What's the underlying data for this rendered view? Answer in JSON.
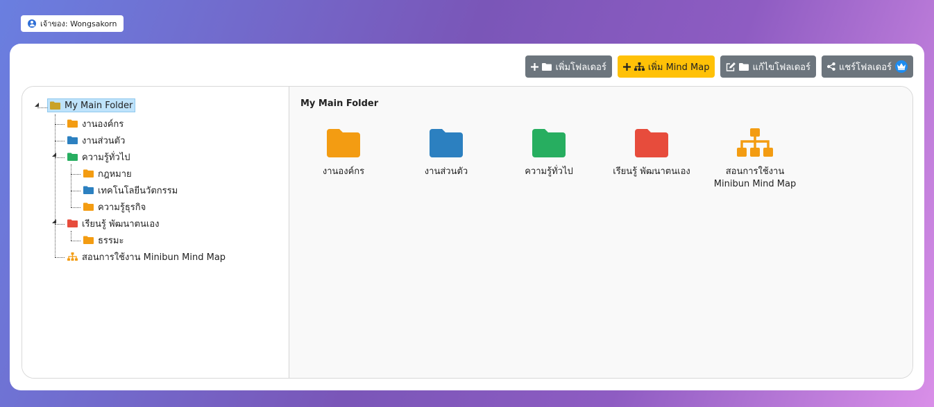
{
  "owner": {
    "label": "เจ้าของ: Wongsakorn",
    "icon": "user-circle-icon"
  },
  "toolbar": {
    "add_folder_label": "เพิ่มโฟลเดอร์",
    "add_mindmap_label": "เพิ่ม Mind Map",
    "edit_folder_label": "แก้ไขโฟลเดอร์",
    "share_folder_label": "แชร์โฟลเดอร์",
    "colors": {
      "secondary": "#6c757d",
      "warning": "#ffc107",
      "premium": "#1d8cf0"
    }
  },
  "tree": {
    "root": {
      "label": "My Main Folder",
      "icon": "folder-icon",
      "color": "#c9a227"
    },
    "nodes": [
      {
        "label": "งานองค์กร",
        "icon": "folder-icon",
        "color": "#f39c12"
      },
      {
        "label": "งานส่วนตัว",
        "icon": "folder-icon",
        "color": "#2c80c0"
      },
      {
        "label": "ความรู้ทั่วไป",
        "icon": "folder-icon",
        "color": "#27ae60"
      },
      {
        "label": "กฎหมาย",
        "icon": "folder-icon",
        "color": "#f39c12"
      },
      {
        "label": "เทคโนโลยีนวัตกรรม",
        "icon": "folder-icon",
        "color": "#2c80c0"
      },
      {
        "label": "ความรู้ธุรกิจ",
        "icon": "folder-icon",
        "color": "#f39c12"
      },
      {
        "label": "เรียนรู้ พัฒนาตนเอง",
        "icon": "folder-icon",
        "color": "#e74c3c"
      },
      {
        "label": "ธรรมะ",
        "icon": "folder-icon",
        "color": "#f39c12"
      },
      {
        "label": "สอนการใช้งาน Minibun Mind Map",
        "icon": "sitemap-icon",
        "color": "#f39c12"
      }
    ]
  },
  "content": {
    "title": "My Main Folder",
    "items": [
      {
        "label": "งานองค์กร",
        "icon": "folder-icon",
        "color": "#f39c12"
      },
      {
        "label": "งานส่วนตัว",
        "icon": "folder-icon",
        "color": "#2c80c0"
      },
      {
        "label": "ความรู้ทั่วไป",
        "icon": "folder-icon",
        "color": "#27ae60"
      },
      {
        "label": "เรียนรู้ พัฒนาตนเอง",
        "icon": "folder-icon",
        "color": "#e74c3c"
      },
      {
        "label_line1": "สอนการใช้งาน",
        "label_line2": "Minibun Mind Map",
        "icon": "sitemap-icon",
        "color": "#f39c12"
      }
    ]
  }
}
